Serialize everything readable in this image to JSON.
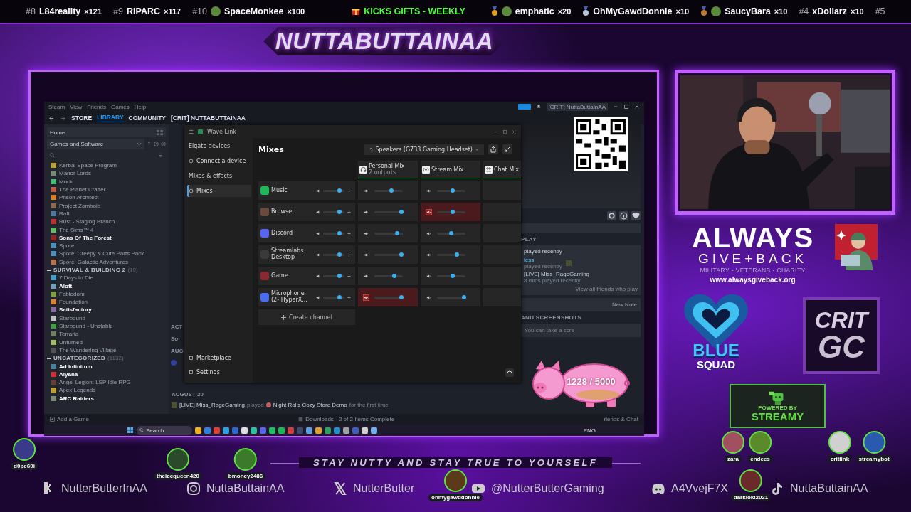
{
  "ticker": [
    {
      "kind": "rank",
      "rank": "#8",
      "name": "L84reality",
      "count": "×121",
      "avatar": false
    },
    {
      "kind": "rank",
      "rank": "#9",
      "name": "RIPARC",
      "count": "×117",
      "avatar": false
    },
    {
      "kind": "rank",
      "rank": "#10",
      "name": "SpaceMonkee",
      "count": "×100",
      "avatar": true
    },
    {
      "kind": "title",
      "name": "KICKS GIFTS - WEEKLY"
    },
    {
      "kind": "medal",
      "name": "emphatic",
      "count": "×20",
      "avatar": true,
      "color": "#e0a020"
    },
    {
      "kind": "medal",
      "name": "OhMyGawdDonnie",
      "count": "×10",
      "avatar": false,
      "color": "#b8c8d8"
    },
    {
      "kind": "medal",
      "name": "SaucyBara",
      "count": "×10",
      "avatar": true,
      "color": "#c07a30"
    },
    {
      "kind": "rank",
      "rank": "#4",
      "name": "xDollarz",
      "count": "×10",
      "avatar": false
    },
    {
      "kind": "rank",
      "rank": "#5",
      "avatar": false
    }
  ],
  "channel_title": "NUTTABUTTAINAA",
  "steam": {
    "menu": [
      "Steam",
      "View",
      "Friends",
      "Games",
      "Help"
    ],
    "account": "[CRIT] NuttaButtaInAA",
    "nav": [
      {
        "label": "STORE",
        "selected": false
      },
      {
        "label": "LIBRARY",
        "selected": true
      },
      {
        "label": "COMMUNITY",
        "selected": false
      },
      {
        "label": "[CRIT] NUTTABUTTAINAA",
        "selected": false
      }
    ],
    "home": "Home",
    "filter": "Games and Software",
    "library": [
      {
        "kind": "game",
        "name": "Kerbal Space Program",
        "installed": false
      },
      {
        "kind": "game",
        "name": "Manor Lords",
        "installed": false
      },
      {
        "kind": "game",
        "name": "Muck",
        "installed": false
      },
      {
        "kind": "game",
        "name": "The Planet Crafter",
        "installed": false
      },
      {
        "kind": "game",
        "name": "Prison Architect",
        "installed": false
      },
      {
        "kind": "game",
        "name": "Project Zomboid",
        "installed": false
      },
      {
        "kind": "game",
        "name": "Raft",
        "installed": false
      },
      {
        "kind": "game",
        "name": "Rust - Staging Branch",
        "installed": false
      },
      {
        "kind": "game",
        "name": "The Sims™ 4",
        "installed": false
      },
      {
        "kind": "game",
        "name": "Sons Of The Forest",
        "installed": true
      },
      {
        "kind": "game",
        "name": "Spore",
        "installed": false
      },
      {
        "kind": "game",
        "name": "Spore: Creepy & Cute Parts Pack",
        "installed": false
      },
      {
        "kind": "game",
        "name": "Spore: Galactic Adventures",
        "installed": false
      },
      {
        "kind": "section",
        "name": "SURVIVAL & BUILDING 2",
        "count": "(10)"
      },
      {
        "kind": "game",
        "name": "7 Days to Die",
        "installed": false
      },
      {
        "kind": "game",
        "name": "Aloft",
        "installed": true
      },
      {
        "kind": "game",
        "name": "Fabledom",
        "installed": false
      },
      {
        "kind": "game",
        "name": "Foundation",
        "installed": false
      },
      {
        "kind": "game",
        "name": "Satisfactory",
        "installed": true
      },
      {
        "kind": "game",
        "name": "Starbound",
        "installed": false
      },
      {
        "kind": "game",
        "name": "Starbound - Unstable",
        "installed": false
      },
      {
        "kind": "game",
        "name": "Terraria",
        "installed": false
      },
      {
        "kind": "game",
        "name": "Unturned",
        "installed": false
      },
      {
        "kind": "game",
        "name": "The Wandering Village",
        "installed": false
      },
      {
        "kind": "section",
        "name": "UNCATEGORIZED",
        "count": "(1132)"
      },
      {
        "kind": "game",
        "name": "Ad Infinitum",
        "installed": true
      },
      {
        "kind": "game",
        "name": "Alyana",
        "installed": true
      },
      {
        "kind": "game",
        "name": "Angel Legion: LSP Idle RPG",
        "installed": false
      },
      {
        "kind": "game",
        "name": "Apex Legends",
        "installed": false
      },
      {
        "kind": "game",
        "name": "ARC Raiders",
        "installed": true
      }
    ],
    "strip": [
      "ACT",
      "So",
      "AUG"
    ],
    "activity": {
      "date": "AUGUST 20",
      "user": "[LIVE] Miss_RageGaming",
      "verb": "played",
      "game": "Night Rolls Cozy Store Demo",
      "tail": "for the first time"
    },
    "play_heading": "PLAY",
    "friends": {
      "heading": "played recently",
      "left_name": "less",
      "left_detail": "played recently",
      "right_name": "[LIVE] Miss_RageGaming",
      "right_detail": "8 mins played recently",
      "link": "View all friends who play"
    },
    "note_button": "New Note",
    "screenshots_heading": "AND SCREENSHOTS",
    "screenshots_text": "You can take a scre",
    "add_game": "Add a Game",
    "downloads": "Downloads - 2 of 2 Items Complete",
    "friends_chat": "riends & Chat"
  },
  "wave_link": {
    "title": "Wave Link",
    "sidebar": [
      {
        "kind": "heading",
        "label": "Elgato devices"
      },
      {
        "kind": "item",
        "label": "Connect a device",
        "selected": false
      },
      {
        "kind": "heading",
        "label": "Mixes & effects"
      },
      {
        "kind": "item",
        "label": "Mixes",
        "selected": true
      }
    ],
    "footer": [
      "Marketplace",
      "Settings"
    ],
    "heading": "Mixes",
    "output": "Speakers (G733 Gaming Headset)",
    "mixes": [
      {
        "name": "Personal Mix",
        "detail": "2 outputs"
      },
      {
        "name": "Stream Mix"
      },
      {
        "name": "Chat Mix"
      }
    ],
    "channels": [
      {
        "name": "Music",
        "level": 0.75,
        "mixes": [
          {
            "level": 0.6,
            "muted": false
          },
          {
            "level": 0.55,
            "muted": false
          }
        ]
      },
      {
        "name": "Browser",
        "level": 0.75,
        "mixes": [
          {
            "level": 0.95,
            "muted": false
          },
          {
            "level": 0.55,
            "muted": true
          }
        ]
      },
      {
        "name": "Discord",
        "level": 0.75,
        "mixes": [
          {
            "level": 0.8,
            "muted": false
          },
          {
            "level": 0.5,
            "muted": false
          }
        ]
      },
      {
        "name": "Streamlabs Desktop",
        "level": 0.75,
        "mixes": [
          {
            "level": 0.95,
            "muted": false
          },
          {
            "level": 0.7,
            "muted": false
          }
        ]
      },
      {
        "name": "Game",
        "level": 0.75,
        "mixes": [
          {
            "level": 0.7,
            "muted": false
          },
          {
            "level": 0.55,
            "muted": false
          }
        ]
      },
      {
        "name": "Microphone (2- HyperX...",
        "level": 0.75,
        "mixes": [
          {
            "level": 0.95,
            "muted": true
          },
          {
            "level": 0.95,
            "muted": false
          }
        ]
      }
    ],
    "create": "Create channel"
  },
  "taskbar": {
    "search": "Search",
    "language": "ENG"
  },
  "goal": "1228 / 5000",
  "charity": {
    "name": "ALWAYS",
    "name2": "GIVE+BACK",
    "tagline": "MILITARY - VETERANS - CHARITY",
    "url": "www.alwaysgiveback.org"
  },
  "squad": [
    "BLUE",
    "SQUAD"
  ],
  "crit": [
    "CRIT",
    "GC"
  ],
  "streamy": [
    "POWERED BY",
    "STREAMY"
  ],
  "motto": "STAY NUTTY AND STAY TRUE TO YOURSELF",
  "socials": [
    "NutterButterInAA",
    "NuttaButtainAA",
    "NutterButter",
    "@NutterButterGaming",
    "A4VvejF7X",
    "NuttaButtainAA"
  ],
  "viewers": [
    "d0pe60i",
    "theicequeen420",
    "bmoney2486",
    "ohmygawddonnie",
    "zara",
    "endees",
    "darkloki2021",
    "critlink",
    "streamybot"
  ]
}
